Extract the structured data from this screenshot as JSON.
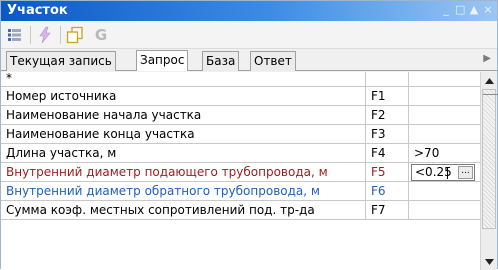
{
  "window": {
    "title": "Участок",
    "controls": [
      "_",
      "□",
      "▲",
      "×"
    ]
  },
  "toolbar": {
    "g_label": "G"
  },
  "tabs": [
    {
      "label": "Текущая запись"
    },
    {
      "label": "Запрос"
    },
    {
      "label": "База"
    },
    {
      "label": "Ответ"
    }
  ],
  "grid": {
    "header_mark": "*",
    "rows": [
      {
        "name": "Номер источника",
        "code": "F1",
        "value": ""
      },
      {
        "name": "Наименование начала участка",
        "code": "F2",
        "value": ""
      },
      {
        "name": "Наименование конца участка",
        "code": "F3",
        "value": ""
      },
      {
        "name": "Длина участка, м",
        "code": "F4",
        "value": ">70"
      },
      {
        "name": "Внутренний диаметр подающего трубопровода, м",
        "code": "F5",
        "value": "<0.25"
      },
      {
        "name": "Внутренний диаметр обратного трубопровода, м",
        "code": "F6",
        "value": ""
      },
      {
        "name": "Сумма коэф. местных сопротивлений под. тр-да",
        "code": "F7",
        "value": ""
      }
    ],
    "editor_button": "..."
  },
  "colors": {
    "title_gradient_start": "#0a58c4",
    "title_gradient_end": "#9cc6f3",
    "highlight_red": "#9c1c1c",
    "highlight_blue": "#1f5fbd"
  }
}
